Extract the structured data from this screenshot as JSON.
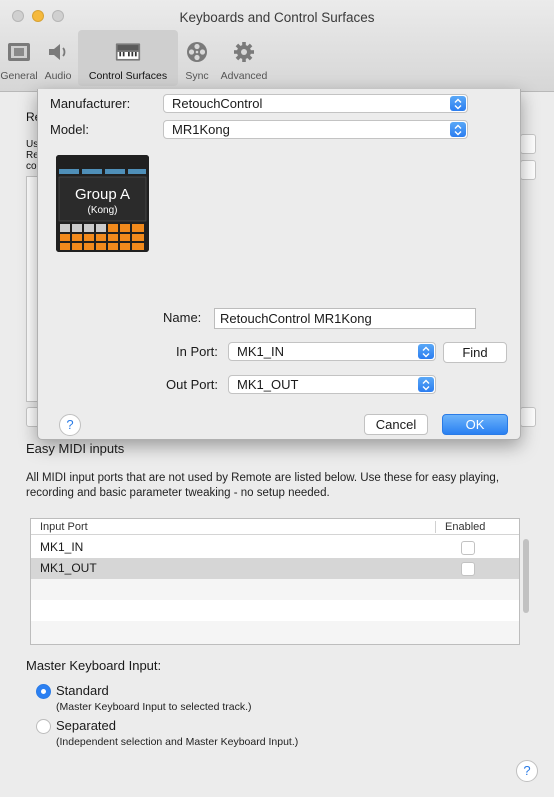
{
  "window": {
    "title": "Keyboards and Control Surfaces",
    "traffic_lights": [
      "#d0d0d0",
      "#f5b93c",
      "#d0d0d0"
    ]
  },
  "toolbar": [
    {
      "label": "General",
      "icon": "switch-icon"
    },
    {
      "label": "Audio",
      "icon": "speaker-icon"
    },
    {
      "label": "Control Surfaces",
      "icon": "keyboard-icon",
      "active": true
    },
    {
      "label": "Sync",
      "icon": "film-reel-icon"
    },
    {
      "label": "Advanced",
      "icon": "gear-icon"
    }
  ],
  "background": {
    "frag_re": "Re",
    "frag_us": "Us",
    "frag_re2": "Re",
    "frag_co": "co"
  },
  "sheet": {
    "manufacturer_label": "Manufacturer:",
    "manufacturer_value": "RetouchControl",
    "model_label": "Model:",
    "model_value": "MR1Kong",
    "device_text": {
      "line1": "Group A",
      "line2": "(Kong)"
    },
    "name_label": "Name:",
    "name_value": "RetouchControl MR1Kong",
    "in_port_label": "In Port:",
    "in_port_value": "MK1_IN",
    "find_label": "Find",
    "out_port_label": "Out Port:",
    "out_port_value": "MK1_OUT",
    "cancel_label": "Cancel",
    "ok_label": "OK",
    "help_glyph": "?"
  },
  "easy_midi": {
    "title": "Easy MIDI inputs",
    "description": "All MIDI input ports that are not used by Remote are listed below. Use these for easy playing, recording and basic parameter tweaking - no setup needed.",
    "columns": [
      "Input Port",
      "Enabled"
    ],
    "rows": [
      {
        "port": "MK1_IN",
        "enabled": false
      },
      {
        "port": "MK1_OUT",
        "enabled": false
      }
    ]
  },
  "master_keyboard": {
    "title": "Master Keyboard Input:",
    "options": [
      {
        "label": "Standard",
        "note": "(Master Keyboard Input to selected track.)",
        "selected": true
      },
      {
        "label": "Separated",
        "note": "(Independent selection and Master Keyboard Input.)",
        "selected": false
      }
    ]
  },
  "footer": {
    "help_glyph": "?"
  },
  "colors": {
    "accent": "#2a7be6",
    "selected_row": "#d6d6d6",
    "window_bg": "#ececec"
  }
}
